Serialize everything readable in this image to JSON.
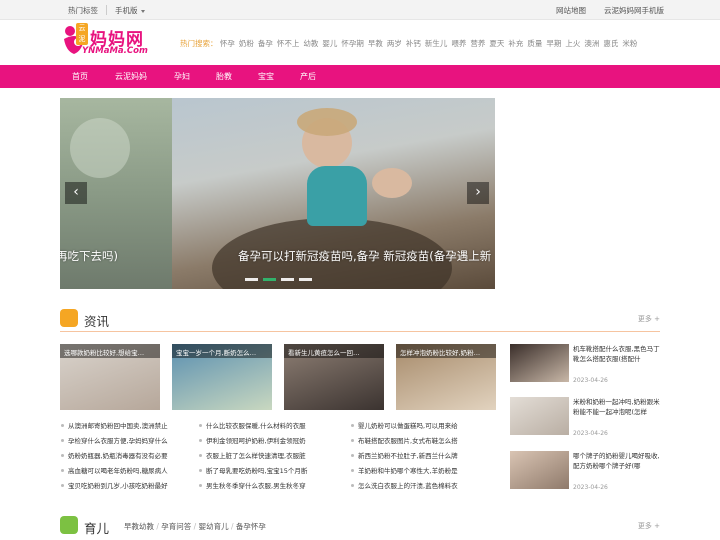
{
  "topbar": {
    "hot_tags": "热门标签",
    "mobile": "手机版",
    "sitemap": "网站地图",
    "mobile_site": "云泥妈妈网手机版"
  },
  "logo": {
    "main": "妈妈网",
    "sub": "YNMaMa.Com",
    "badge": "云泥"
  },
  "hot_search": {
    "label": "热门搜索：",
    "keywords": [
      "怀孕",
      "奶粉",
      "备孕",
      "怀不上",
      "幼教",
      "婴儿",
      "怀孕期",
      "早教",
      "两岁",
      "补钙",
      "新生儿",
      "喂养",
      "营养",
      "夏天",
      "补充",
      "质量",
      "早期",
      "上火",
      "澳洲",
      "惠氏",
      "米粉"
    ]
  },
  "nav": {
    "items": [
      "首页",
      "云泥妈妈",
      "孕妇",
      "胎教",
      "宝宝",
      "产后"
    ]
  },
  "slider": {
    "caption_left": "再吃下去吗)",
    "caption_main": "备孕可以打新冠疫苗吗,备孕 新冠疫苗(备孕遇上新",
    "prev": "‹",
    "next": "›",
    "dots": 4,
    "active_dot": 1
  },
  "section_info": {
    "title": "资讯",
    "more": "更多 +",
    "icon": "news-icon",
    "thumbs": [
      "选哪款奶粉比较好,想给宝…",
      "宝宝一岁一个月,断奶怎么…",
      "看新生儿黄疸怎么一回…",
      "怎样冲泡奶粉比较好,奶粉…"
    ],
    "columns": [
      [
        "从澳洲邮寄奶粉回中国卖,澳洲禁止",
        "孕检穿什么衣服方便,孕妈妈穿什么",
        "奶粉奶瓶器,奶瓶消毒器有没有必要",
        "高血糖可以喝老年奶粉吗,糖尿病人",
        "宝贝吃奶粉到几岁,小孩吃奶粉最好"
      ],
      [
        "什么比较衣服保暖,什么材料的衣服",
        "伊利金领冠呵护奶粉,伊利金领冠奶",
        "衣服上脏了怎么样快速清理,衣服脏",
        "断了母乳要吃奶粉吗,宝宝15个月断",
        "男生秋冬季穿什么衣服,男生秋冬穿"
      ],
      [
        "婴儿奶粉可以做蛋糕吗,可以用来给",
        "布鞋搭配衣服图片,女式布鞋怎么搭",
        "新西兰奶粉不拉肚子,新西兰什么牌",
        "羊奶粉和牛奶哪个寒性大,羊奶粉是",
        "怎么洗白衣服上的汗渍,蓝色棉料衣"
      ]
    ],
    "side": [
      {
        "title": "机车靴搭配什么衣服,黑色马丁靴怎么搭配衣服(搭配什",
        "date": "2023-04-26"
      },
      {
        "title": "米粉和奶粉一起冲吗,奶粉跟米粉能不能一起冲泡呢(怎样",
        "date": "2023-04-26"
      },
      {
        "title": "哪个牌子的奶粉婴儿喝好吸收,配方奶粉哪个牌子好(哪",
        "date": "2023-04-26"
      }
    ]
  },
  "section_child": {
    "title": "育儿",
    "more": "更多 +",
    "icon": "child-icon",
    "tabs": [
      "早教幼教",
      "孕育问答",
      "婴幼育儿",
      "备孕怀孕"
    ]
  },
  "colors": {
    "brand": "#e8137f",
    "accent": "#f5a623",
    "green": "#7cc142"
  }
}
